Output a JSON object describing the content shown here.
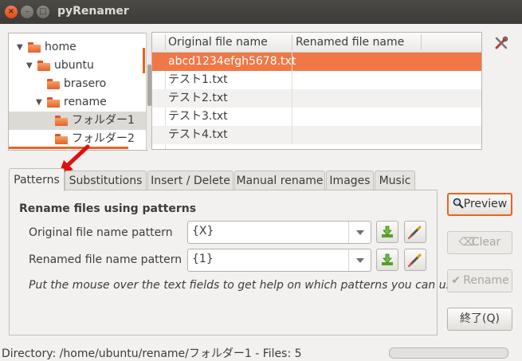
{
  "window": {
    "title": "pyRenamer"
  },
  "tree": {
    "items": [
      {
        "label": "home",
        "expanded": true
      },
      {
        "label": "ubuntu",
        "expanded": true
      },
      {
        "label": "brasero",
        "expanded": false
      },
      {
        "label": "rename",
        "expanded": true
      },
      {
        "label": "フォルダー1",
        "selected": true
      },
      {
        "label": "フォルダー2"
      }
    ]
  },
  "files": {
    "col_original": "Original file name",
    "col_renamed": "Renamed file name",
    "rows": [
      {
        "original": "abcd1234efgh5678.txt",
        "renamed": "",
        "selected": true
      },
      {
        "original": "テスト1.txt",
        "renamed": ""
      },
      {
        "original": "テスト2.txt",
        "renamed": ""
      },
      {
        "original": "テスト3.txt",
        "renamed": ""
      },
      {
        "original": "テスト4.txt",
        "renamed": ""
      }
    ]
  },
  "tabs": [
    {
      "label": "Patterns",
      "active": true
    },
    {
      "label": "Substitutions"
    },
    {
      "label": "Insert / Delete"
    },
    {
      "label": "Manual rename"
    },
    {
      "label": "Images"
    },
    {
      "label": "Music"
    }
  ],
  "patterns": {
    "title": "Rename files using patterns",
    "original_label": "Original file name pattern",
    "original_value": "{X}",
    "renamed_label": "Renamed file name pattern",
    "renamed_value": "{1}",
    "hint": "Put the mouse over the text fields to get help on which patterns you can use"
  },
  "buttons": {
    "preview": "Preview",
    "clear": "Clear",
    "rename": "Rename",
    "quit": "終了(Q)"
  },
  "status": {
    "text": "Directory: /home/ubuntu/rename/フォルダー1 - Files: 5",
    "progress": 0
  },
  "colors": {
    "accent": "#e9631f",
    "selection": "#f07746"
  }
}
